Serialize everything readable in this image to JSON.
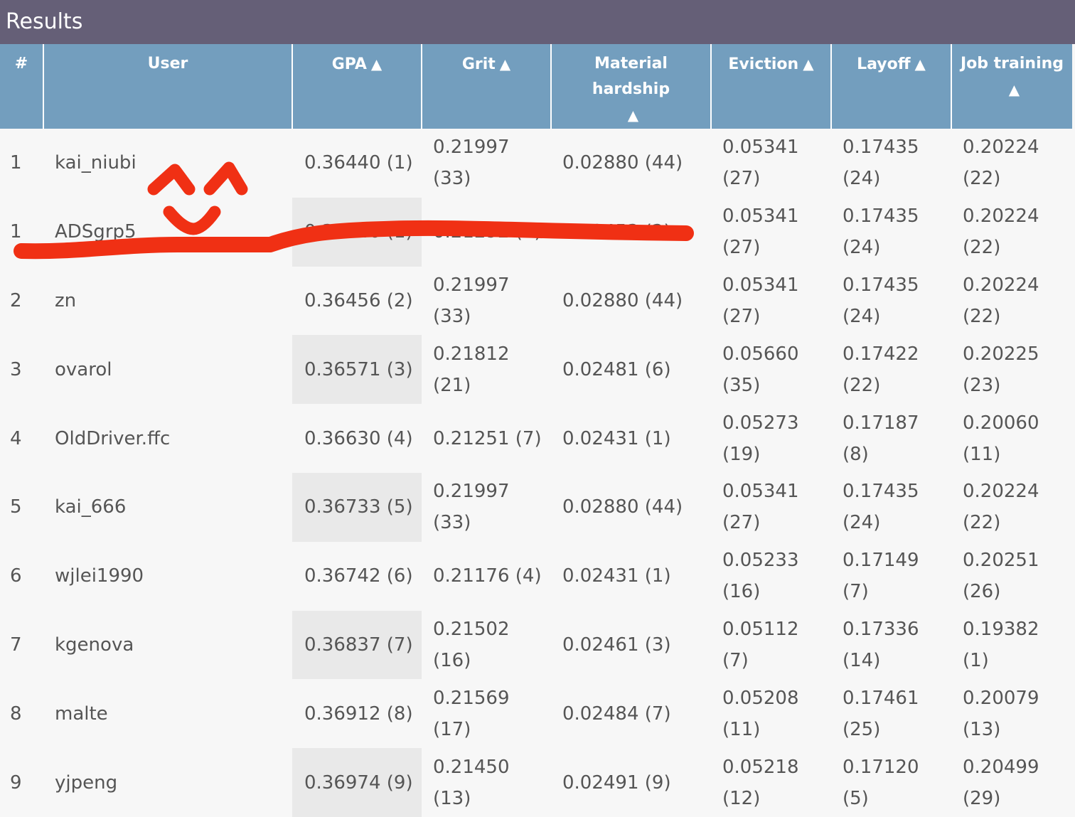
{
  "title": "Results",
  "columns": [
    "#",
    "User",
    "GPA",
    "Grit",
    "Material hardship",
    "Eviction",
    "Layoff",
    "Job training"
  ],
  "rows": [
    {
      "rank": "1",
      "user": "kai_niubi",
      "gpa": "0.36440 (1)",
      "grit": "0.21997 (33)",
      "hardship": "0.02880 (44)",
      "eviction": "0.05341 (27)",
      "layoff": "0.17435 (24)",
      "job": "0.20224 (22)"
    },
    {
      "rank": "1",
      "user": "ADSgrp5",
      "gpa": "0.36440 (1)",
      "grit": "0.21292 (8)",
      "hardship": "0.02453 (2)",
      "eviction": "0.05341 (27)",
      "layoff": "0.17435 (24)",
      "job": "0.20224 (22)"
    },
    {
      "rank": "2",
      "user": "zn",
      "gpa": "0.36456 (2)",
      "grit": "0.21997 (33)",
      "hardship": "0.02880 (44)",
      "eviction": "0.05341 (27)",
      "layoff": "0.17435 (24)",
      "job": "0.20224 (22)"
    },
    {
      "rank": "3",
      "user": "ovarol",
      "gpa": "0.36571 (3)",
      "grit": "0.21812 (21)",
      "hardship": "0.02481 (6)",
      "eviction": "0.05660 (35)",
      "layoff": "0.17422 (22)",
      "job": "0.20225 (23)"
    },
    {
      "rank": "4",
      "user": "OldDriver.ffc",
      "gpa": "0.36630 (4)",
      "grit": "0.21251 (7)",
      "hardship": "0.02431 (1)",
      "eviction": "0.05273 (19)",
      "layoff": "0.17187 (8)",
      "job": "0.20060 (11)"
    },
    {
      "rank": "5",
      "user": "kai_666",
      "gpa": "0.36733 (5)",
      "grit": "0.21997 (33)",
      "hardship": "0.02880 (44)",
      "eviction": "0.05341 (27)",
      "layoff": "0.17435 (24)",
      "job": "0.20224 (22)"
    },
    {
      "rank": "6",
      "user": "wjlei1990",
      "gpa": "0.36742 (6)",
      "grit": "0.21176 (4)",
      "hardship": "0.02431 (1)",
      "eviction": "0.05233 (16)",
      "layoff": "0.17149 (7)",
      "job": "0.20251 (26)"
    },
    {
      "rank": "7",
      "user": "kgenova",
      "gpa": "0.36837 (7)",
      "grit": "0.21502 (16)",
      "hardship": "0.02461 (3)",
      "eviction": "0.05112 (7)",
      "layoff": "0.17336 (14)",
      "job": "0.19382 (1)"
    },
    {
      "rank": "8",
      "user": "malte",
      "gpa": "0.36912 (8)",
      "grit": "0.21569 (17)",
      "hardship": "0.02484 (7)",
      "eviction": "0.05208 (11)",
      "layoff": "0.17461 (25)",
      "job": "0.20079 (13)"
    },
    {
      "rank": "9",
      "user": "yjpeng",
      "gpa": "0.36974 (9)",
      "grit": "0.21450 (13)",
      "hardship": "0.02491 (9)",
      "eviction": "0.05218 (12)",
      "layoff": "0.17120 (5)",
      "job": "0.20499 (29)"
    }
  ],
  "icons": {
    "sort": "sort-ascending-triangle-icon"
  },
  "colors": {
    "titlebar": "#655f77",
    "header": "#739ebe",
    "highlight": "#e9e9e9",
    "annotation": "#f03014"
  }
}
